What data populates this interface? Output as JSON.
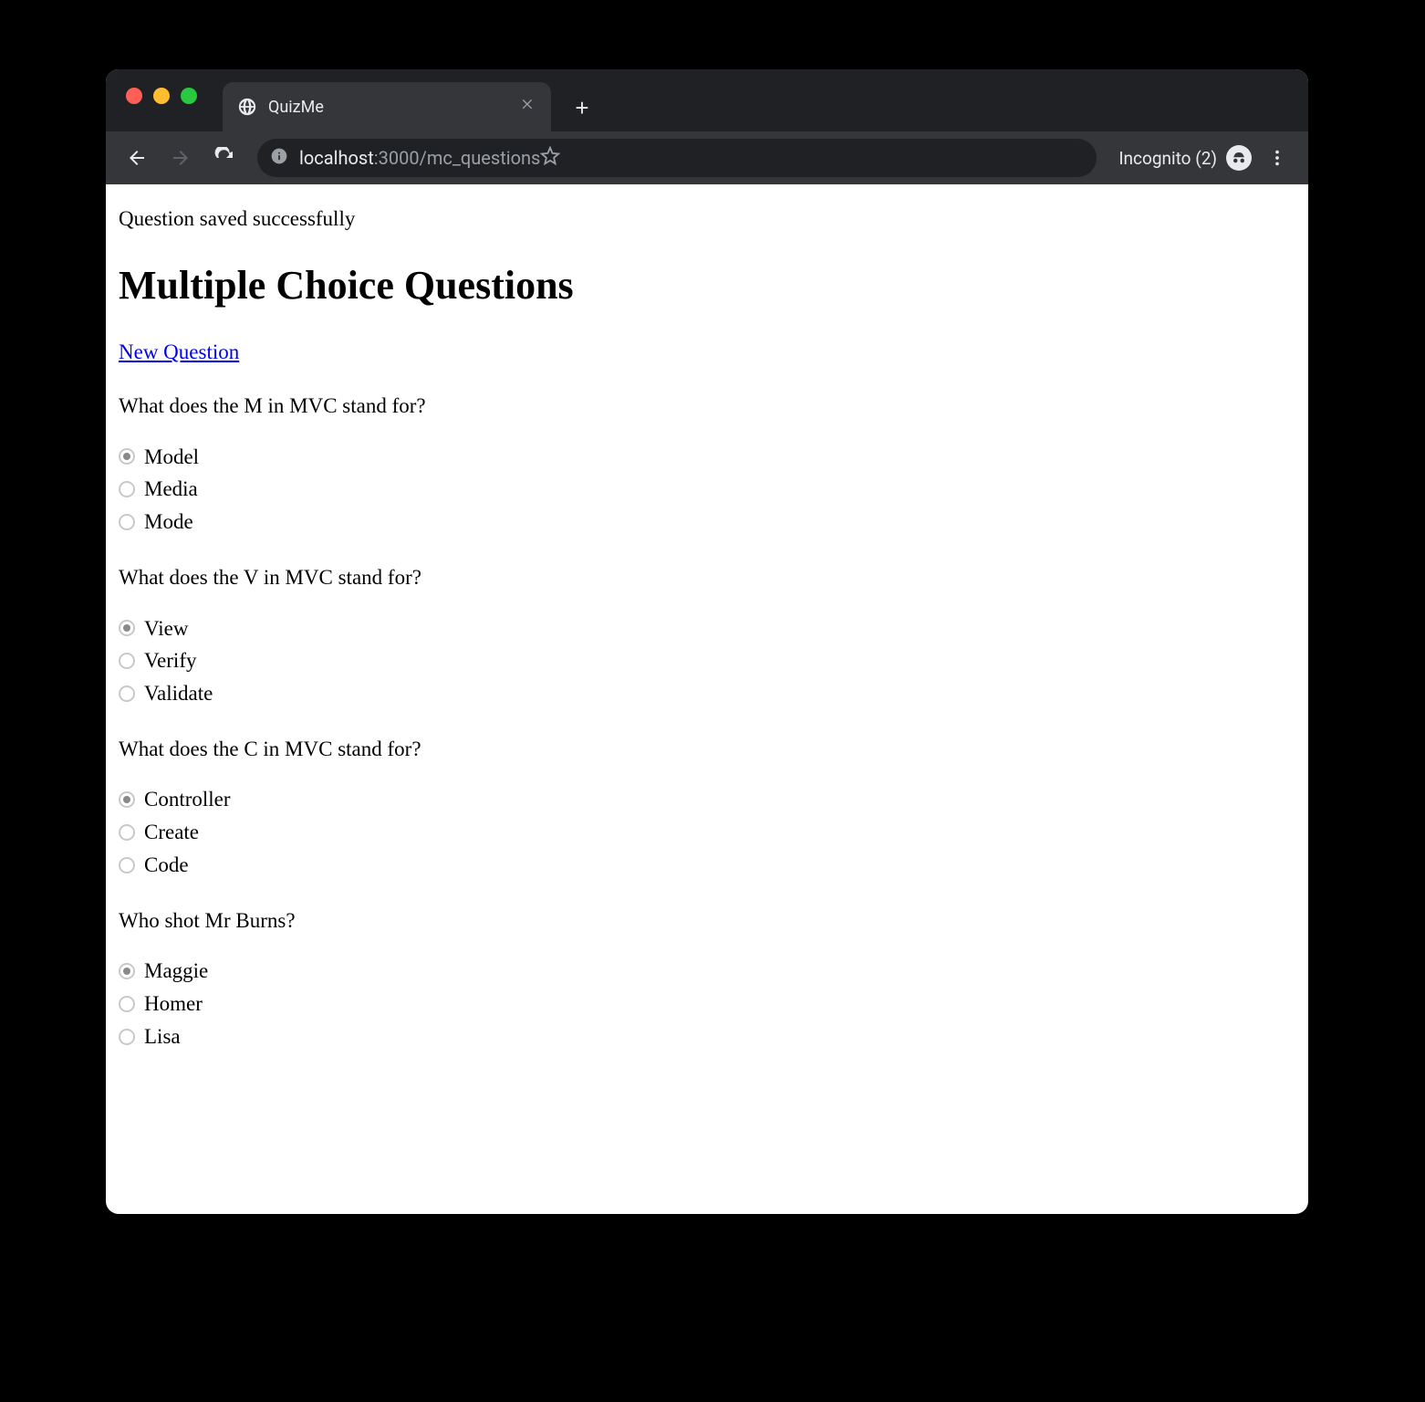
{
  "browser": {
    "tab_title": "QuizMe",
    "url_host": "localhost",
    "url_port_path": ":3000/mc_questions",
    "incognito_label": "Incognito (2)"
  },
  "page": {
    "flash": "Question saved successfully",
    "heading": "Multiple Choice Questions",
    "new_link": "New Question"
  },
  "questions": [
    {
      "text": "What does the M in MVC stand for?",
      "answers": [
        {
          "label": "Model",
          "checked": true
        },
        {
          "label": "Media",
          "checked": false
        },
        {
          "label": "Mode",
          "checked": false
        }
      ]
    },
    {
      "text": "What does the V in MVC stand for?",
      "answers": [
        {
          "label": "View",
          "checked": true
        },
        {
          "label": "Verify",
          "checked": false
        },
        {
          "label": "Validate",
          "checked": false
        }
      ]
    },
    {
      "text": "What does the C in MVC stand for?",
      "answers": [
        {
          "label": "Controller",
          "checked": true
        },
        {
          "label": "Create",
          "checked": false
        },
        {
          "label": "Code",
          "checked": false
        }
      ]
    },
    {
      "text": "Who shot Mr Burns?",
      "answers": [
        {
          "label": "Maggie",
          "checked": true
        },
        {
          "label": "Homer",
          "checked": false
        },
        {
          "label": "Lisa",
          "checked": false
        }
      ]
    }
  ]
}
